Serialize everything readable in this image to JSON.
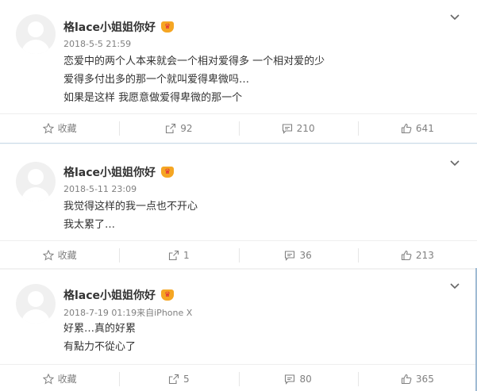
{
  "posts": [
    {
      "username": "格lace小姐姐你好",
      "badge": "♛",
      "meta": "2018-5-5 21:59",
      "lines": [
        "恋爱中的两个人本来就会一个相对爱得多 一个相对爱的少",
        "爱得多付出多的那一个就叫爱得卑微吗…",
        "如果是这样 我愿意做爱得卑微的那一个"
      ],
      "collect_label": "收藏",
      "repost_count": "92",
      "comment_count": "210",
      "like_count": "641"
    },
    {
      "username": "格lace小姐姐你好",
      "badge": "♛",
      "meta": "2018-5-11 23:09",
      "lines": [
        "我觉得这样的我一点也不开心",
        "我太累了…"
      ],
      "collect_label": "收藏",
      "repost_count": "1",
      "comment_count": "36",
      "like_count": "213"
    },
    {
      "username": "格lace小姐姐你好",
      "badge": "♛",
      "meta": "2018-7-19 01:19来自iPhone X",
      "lines": [
        "好累…真的好累",
        "有點力不從心了"
      ],
      "collect_label": "收藏",
      "repost_count": "5",
      "comment_count": "80",
      "like_count": "365"
    }
  ],
  "icons": {
    "avatar": "default-avatar-icon",
    "menu": "chevron-down-icon",
    "collect": "star-icon",
    "repost": "share-arrow-icon",
    "comment": "comment-bubble-icon",
    "like": "thumbs-up-icon"
  },
  "colors": {
    "text": "#333333",
    "meta": "#808080",
    "badge": "#f5a623"
  }
}
